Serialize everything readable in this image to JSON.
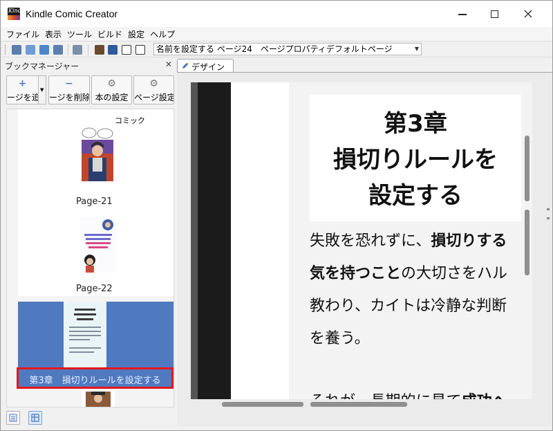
{
  "window": {
    "title": "Kindle Comic Creator",
    "app_icon_text": "Kindle"
  },
  "menu": [
    "ファイル",
    "表示",
    "ツール",
    "ビルド",
    "設定",
    "ヘルプ"
  ],
  "toolbar": {
    "page_select_value": "名前を設定する ページ24　ページプロパティデフォルトページ"
  },
  "book_manager": {
    "title": "ブックマネージャー",
    "buttons": [
      {
        "label": "ージを追",
        "icon": "+"
      },
      {
        "label": "ージを削除",
        "icon": "−"
      },
      {
        "label": "本の設定",
        "icon": "⚙"
      },
      {
        "label": "ページ設定",
        "icon": "⚙"
      }
    ],
    "comic_label": "コミック",
    "pages": [
      {
        "label": "Page-21"
      },
      {
        "label": "Page-22"
      }
    ],
    "selected_page_label": "第3章　損切りルールを設定する"
  },
  "design": {
    "tab_label": "デザイン",
    "chapter_title_lines": [
      "第3章",
      "損切りルールを",
      "設定する"
    ],
    "body_lines": [
      [
        "失敗を恐れずに、",
        "損切りする"
      ],
      [
        "気を持つこと",
        "の大切さをハル"
      ],
      [
        "教わり、カイトは冷静な判断"
      ],
      [
        "を養う。"
      ],
      [
        "それが、長期的に見て",
        "成功へ"
      ]
    ]
  },
  "colors": {
    "selection": "#4f7ac0",
    "highlight_border": "#e8161d",
    "arrow": "#e8161d"
  }
}
